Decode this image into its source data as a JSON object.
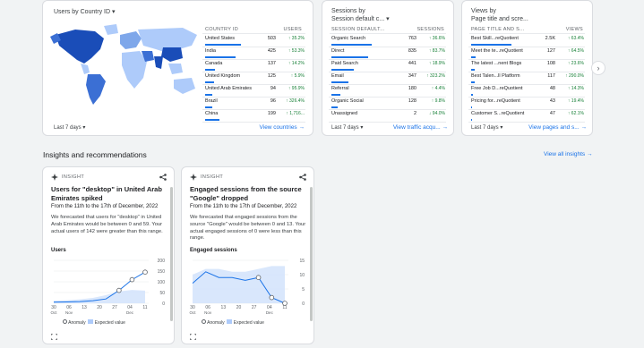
{
  "countries_card": {
    "metric": "Users",
    "dimension": "by Country ID",
    "col_dim": "COUNTRY ID",
    "col_metric": "USERS",
    "rows": [
      {
        "label": "United States",
        "value": "503",
        "pct": "↑ 35.2%",
        "bar": 1.0
      },
      {
        "label": "India",
        "value": "425",
        "pct": "↑ 53.3%",
        "bar": 0.85
      },
      {
        "label": "Canada",
        "value": "137",
        "pct": "↑ 14.2%",
        "bar": 0.27
      },
      {
        "label": "United Kingdom",
        "value": "125",
        "pct": "↑ 5.9%",
        "bar": 0.25
      },
      {
        "label": "United Arab Emirates",
        "value": "94",
        "pct": "↑ 95.9%",
        "bar": 0.19
      },
      {
        "label": "Brazil",
        "value": "96",
        "pct": "↑ 326.4%",
        "bar": 0.19
      },
      {
        "label": "China",
        "value": "199",
        "pct": "↑ 1,716...",
        "bar": 0.4
      }
    ],
    "date_range": "Last 7 days",
    "link": "View countries"
  },
  "sessions_card": {
    "metric": "Sessions",
    "dimension": "by",
    "dimension2": "Session default c...",
    "col_dim": "SESSION DEFAULT...",
    "col_metric": "SESSIONS",
    "rows": [
      {
        "label": "Organic Search",
        "value": "763",
        "pct": "↑ 36.6%",
        "bar": 1.0
      },
      {
        "label": "Direct",
        "value": "835",
        "pct": "↑ 83.7%",
        "bar": 0.9
      },
      {
        "label": "Paid Search",
        "value": "441",
        "pct": "↑ 18.9%",
        "bar": 0.55
      },
      {
        "label": "Email",
        "value": "347",
        "pct": "↑ 323.2%",
        "bar": 0.42
      },
      {
        "label": "Referral",
        "value": "180",
        "pct": "↑ 4.4%",
        "bar": 0.22
      },
      {
        "label": "Organic Social",
        "value": "128",
        "pct": "↑ 9.8%",
        "bar": 0.16
      },
      {
        "label": "Unassigned",
        "value": "2",
        "pct": "↓ 94.0%",
        "bar": 0.0
      }
    ],
    "date_range": "Last 7 days",
    "link": "View traffic acqu..."
  },
  "pages_card": {
    "metric": "Views by",
    "dimension": "Page title and scre...",
    "col_dim": "PAGE TITLE AND S...",
    "col_metric": "VIEWS",
    "rows": [
      {
        "label": "Best Skill...reQuotient",
        "value": "2.5K",
        "pct": "↑ 63.4%",
        "bar": 1.0
      },
      {
        "label": "Meet the te...reQuotient",
        "value": "127",
        "pct": "↑ 64.5%",
        "bar": 0.1
      },
      {
        "label": "The latest ...nent Blogs",
        "value": "108",
        "pct": "↑ 23.6%",
        "bar": 0.08
      },
      {
        "label": "Best Talen...ll Platform",
        "value": "117",
        "pct": "↑ 290.0%",
        "bar": 0.08
      },
      {
        "label": "Free Job D...reQuotient",
        "value": "48",
        "pct": "↑ 14.3%",
        "bar": 0.04
      },
      {
        "label": "Pricing for...reQuotient",
        "value": "43",
        "pct": "↑ 19.4%",
        "bar": 0.03
      },
      {
        "label": "Customer S...reQuotient",
        "value": "47",
        "pct": "↑ 62.1%",
        "bar": 0.03
      }
    ],
    "date_range": "Last 7 days",
    "link": "View pages and s..."
  },
  "section": {
    "title": "Insights and recommendations",
    "view_all": "View all insights"
  },
  "insight1": {
    "tag": "INSIGHT",
    "headline": "Users for \"desktop\" in United Arab Emirates spiked",
    "date": "From the 11th to the 17th of December, 2022",
    "body": "We forecasted that users for \"desktop\" in United Arab Emirates would be between 0 and 59. Your actual users of 142 were greater than this range.",
    "chart_label": "Users",
    "y_ticks": [
      "200",
      "150",
      "100",
      "50",
      "0"
    ],
    "x_ticks": [
      "30",
      "06",
      "13",
      "20",
      "27",
      "04",
      "11"
    ],
    "x_sub": [
      "Oct",
      "Nov",
      "",
      "",
      "",
      "Dec",
      ""
    ],
    "legend_anomaly": "Anomaly",
    "legend_expected": "Expected value"
  },
  "insight2": {
    "tag": "INSIGHT",
    "headline": "Engaged sessions from the source \"Google\" dropped",
    "date": "From the 11th to the 17th of December, 2022",
    "body": "We forecasted that engaged sessions from the source \"Google\" would be between 0 and 13. Your actual engaged sessions of 0 were less than this range.",
    "chart_label": "Engaged sessions",
    "y_ticks": [
      "15",
      "10",
      "5",
      "0"
    ],
    "x_ticks": [
      "30",
      "06",
      "13",
      "20",
      "27",
      "04",
      "11"
    ],
    "x_sub": [
      "Oct",
      "Nov",
      "",
      "",
      "",
      "Dec",
      ""
    ],
    "legend_anomaly": "Anomaly",
    "legend_expected": "Expected value"
  },
  "colors": {
    "accent": "#1a73e8",
    "positive": "#188038",
    "map_dark": "#1a4db8",
    "map_light": "#aecbfa"
  }
}
